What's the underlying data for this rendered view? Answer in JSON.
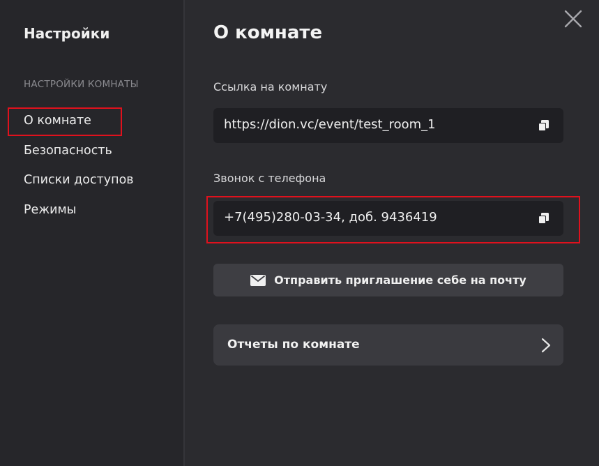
{
  "sidebar": {
    "title": "Настройки",
    "section": "НАСТРОЙКИ КОМНАТЫ",
    "items": [
      {
        "label": "О комнате",
        "selected": true
      },
      {
        "label": "Безопасность"
      },
      {
        "label": "Списки доступов"
      },
      {
        "label": "Режимы"
      }
    ]
  },
  "main": {
    "title": "О комнате",
    "room_link": {
      "label": "Ссылка на комнату",
      "value": "https://dion.vc/event/test_room_1",
      "icon": "copy-icon"
    },
    "phone": {
      "label": "Звонок с телефона",
      "value": "+7(495)280-03-34, доб. 9436419",
      "icon": "copy-icon"
    },
    "invite_button": {
      "label": "Отправить приглашение себе на почту",
      "icon": "envelope-icon"
    },
    "reports": {
      "label": "Отчеты по комнате",
      "icon": "chevron-right-icon"
    }
  },
  "close_icon": "close-icon",
  "colors": {
    "sidebar_bg": "#26262a",
    "main_bg": "#2b2b2f",
    "field_bg": "#1f1f23",
    "button_bg": "#3e3e43",
    "highlight": "#e0111d"
  }
}
